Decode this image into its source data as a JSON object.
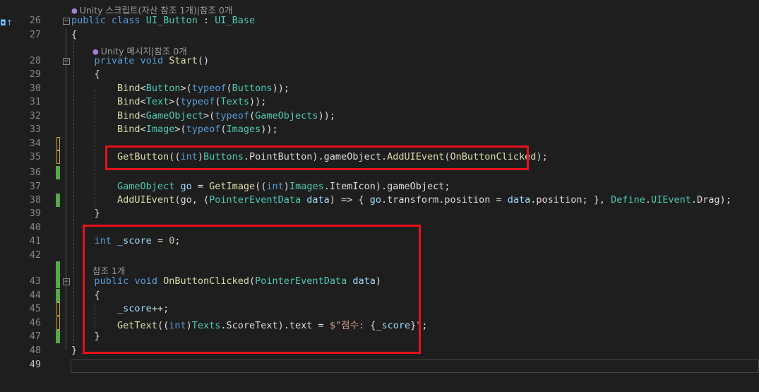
{
  "editor": {
    "top_lens": "Unity 스크립트(자산 참조 1개)|참조 0개",
    "lines": [
      {
        "n": "26",
        "code": "public class UI_Button : UI_Base"
      },
      {
        "n": "27",
        "code": "{"
      },
      {
        "lens": "Unity 메시지|참조 0개"
      },
      {
        "n": "28",
        "code": "    private void Start()"
      },
      {
        "n": "29",
        "code": "    {"
      },
      {
        "n": "30",
        "code": "        Bind<Button>(typeof(Buttons));"
      },
      {
        "n": "31",
        "code": "        Bind<Text>(typeof(Texts));"
      },
      {
        "n": "32",
        "code": "        Bind<GameObject>(typeof(GameObjects));"
      },
      {
        "n": "33",
        "code": "        Bind<Image>(typeof(Images));"
      },
      {
        "n": "34",
        "code": ""
      },
      {
        "n": "35",
        "code": "        GetButton((int)Buttons.PointButton).gameObject.AddUIEvent(OnButtonClicked);"
      },
      {
        "n": "36",
        "code": ""
      },
      {
        "n": "37",
        "code": "        GameObject go = GetImage((int)Images.ItemIcon).gameObject;"
      },
      {
        "n": "38",
        "code": "        AddUIEvent(go, (PointerEventData data) => { go.transform.position = data.position; }, Define.UIEvent.Drag);"
      },
      {
        "n": "39",
        "code": "    }"
      },
      {
        "n": "40",
        "code": ""
      },
      {
        "n": "41",
        "code": "    int _score = 0;"
      },
      {
        "n": "42",
        "code": ""
      },
      {
        "lens": "참조 1개"
      },
      {
        "n": "43",
        "code": "    public void OnButtonClicked(PointerEventData data)"
      },
      {
        "n": "44",
        "code": "    {"
      },
      {
        "n": "45",
        "code": "        _score++;"
      },
      {
        "n": "46",
        "code": "        GetText((int)Texts.ScoreText).text = $\"점수: {_score}\";"
      },
      {
        "n": "47",
        "code": "    }"
      },
      {
        "n": "48",
        "code": "}"
      },
      {
        "n": "49",
        "code": ""
      }
    ]
  },
  "gutter_colors": {
    "added": "#57a64a",
    "modified": "#c7a33b"
  },
  "highlight_color": "#e8101c",
  "icons": {
    "bookmark": "bookmark-arrow-icon",
    "lens": "unity-cube-icon",
    "fold": "fold-collapse-icon"
  }
}
